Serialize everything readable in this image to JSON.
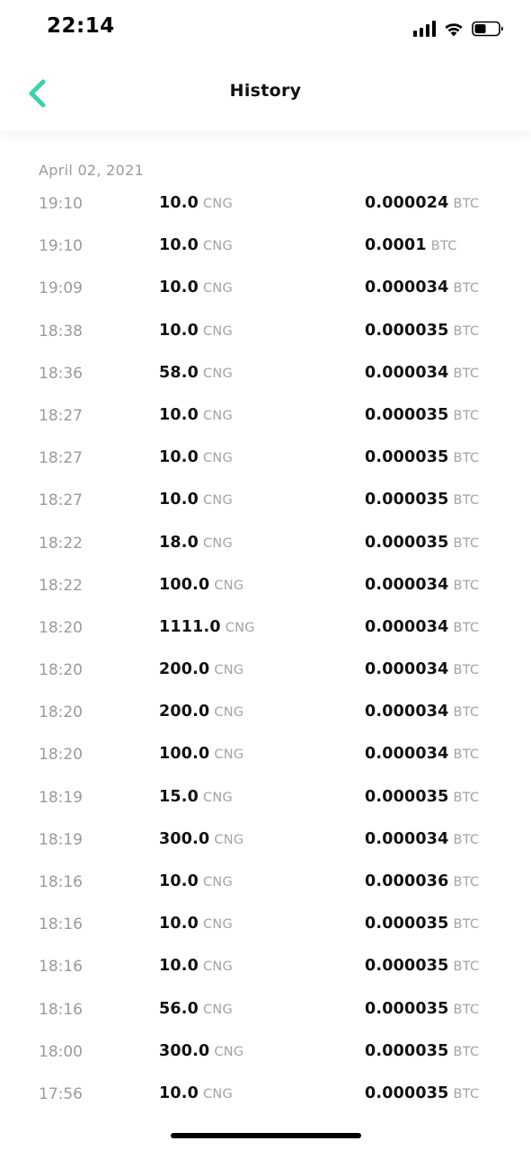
{
  "status_bar": {
    "time": "22:14"
  },
  "header": {
    "title": "History"
  },
  "colors": {
    "accent": "#3ecfae"
  },
  "history": {
    "date": "April 02, 2021",
    "unit_amount": "CNG",
    "unit_price": "BTC",
    "rows": [
      {
        "time": "19:10",
        "amount": "10.0",
        "price": "0.000024"
      },
      {
        "time": "19:10",
        "amount": "10.0",
        "price": "0.0001"
      },
      {
        "time": "19:09",
        "amount": "10.0",
        "price": "0.000034"
      },
      {
        "time": "18:38",
        "amount": "10.0",
        "price": "0.000035"
      },
      {
        "time": "18:36",
        "amount": "58.0",
        "price": "0.000034"
      },
      {
        "time": "18:27",
        "amount": "10.0",
        "price": "0.000035"
      },
      {
        "time": "18:27",
        "amount": "10.0",
        "price": "0.000035"
      },
      {
        "time": "18:27",
        "amount": "10.0",
        "price": "0.000035"
      },
      {
        "time": "18:22",
        "amount": "18.0",
        "price": "0.000035"
      },
      {
        "time": "18:22",
        "amount": "100.0",
        "price": "0.000034"
      },
      {
        "time": "18:20",
        "amount": "1111.0",
        "price": "0.000034"
      },
      {
        "time": "18:20",
        "amount": "200.0",
        "price": "0.000034"
      },
      {
        "time": "18:20",
        "amount": "200.0",
        "price": "0.000034"
      },
      {
        "time": "18:20",
        "amount": "100.0",
        "price": "0.000034"
      },
      {
        "time": "18:19",
        "amount": "15.0",
        "price": "0.000035"
      },
      {
        "time": "18:19",
        "amount": "300.0",
        "price": "0.000034"
      },
      {
        "time": "18:16",
        "amount": "10.0",
        "price": "0.000036"
      },
      {
        "time": "18:16",
        "amount": "10.0",
        "price": "0.000035"
      },
      {
        "time": "18:16",
        "amount": "10.0",
        "price": "0.000035"
      },
      {
        "time": "18:16",
        "amount": "56.0",
        "price": "0.000035"
      },
      {
        "time": "18:00",
        "amount": "300.0",
        "price": "0.000035"
      },
      {
        "time": "17:56",
        "amount": "10.0",
        "price": "0.000035"
      }
    ]
  }
}
